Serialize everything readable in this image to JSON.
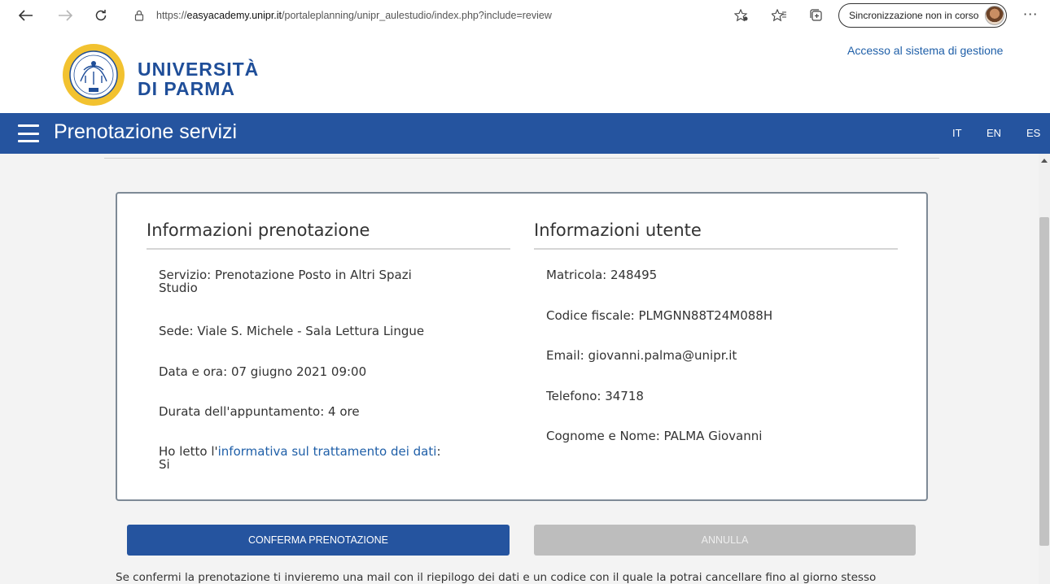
{
  "browser": {
    "url_prefix": "https://",
    "url_domain": "easyacademy.unipr.it",
    "url_path": "/portaleplanning/unipr_aulestudio/index.php?include=review",
    "sync_label": "Sincronizzazione non in corso",
    "more_label": "···"
  },
  "header": {
    "logo_line1": "UNIVERSITÀ",
    "logo_line2": "DI PARMA",
    "management_link": "Accesso al sistema di gestione"
  },
  "nav": {
    "title": "Prenotazione servizi",
    "languages": [
      "IT",
      "EN",
      "ES"
    ]
  },
  "booking": {
    "title": "Informazioni prenotazione",
    "service_line1": "Servizio: Prenotazione Posto in Altri Spazi",
    "service_line2": "Studio",
    "location": "Sede: Viale S. Michele - Sala Lettura Lingue",
    "datetime": "Data e ora: 07 giugno 2021 09:00",
    "duration": "Durata dell'appuntamento: 4 ore",
    "privacy_prefix": "Ho letto l'",
    "privacy_link": "informativa sul trattamento dei dati",
    "privacy_suffix": ":",
    "privacy_answer": "Si"
  },
  "user": {
    "title": "Informazioni utente",
    "matricola": "Matricola: 248495",
    "codice_fiscale": "Codice fiscale: PLMGNN88T24M088H",
    "email": "Email: giovanni.palma@unipr.it",
    "telefono": "Telefono: 34718",
    "nome": "Cognome e Nome: PALMA Giovanni"
  },
  "actions": {
    "confirm_label": "CONFERMA PRENOTAZIONE",
    "cancel_label": "ANNULLA"
  },
  "footnote": "Se confermi la prenotazione ti invieremo una mail con il riepilogo dei dati e un codice con il quale la potrai cancellare fino al giorno stesso",
  "colors": {
    "brand_blue": "#25549f",
    "link_blue": "#1f5fa8",
    "disabled_gray": "#bdbdbd"
  }
}
